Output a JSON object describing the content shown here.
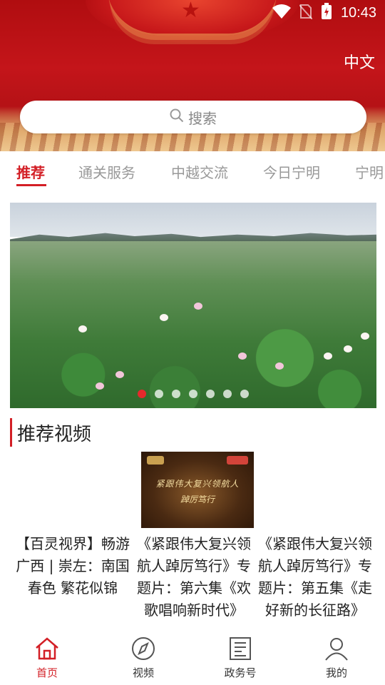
{
  "status": {
    "time": "10:43",
    "icons": [
      "wifi-icon",
      "no-sim-icon",
      "battery-charging-icon"
    ]
  },
  "header": {
    "language": "中文"
  },
  "search": {
    "placeholder": "搜索",
    "icon": "search-icon"
  },
  "tabs": [
    {
      "label": "推荐",
      "active": true
    },
    {
      "label": "通关服务",
      "active": false
    },
    {
      "label": "中越交流",
      "active": false
    },
    {
      "label": "今日宁明",
      "active": false
    },
    {
      "label": "宁明",
      "active": false
    }
  ],
  "banner": {
    "slide_count": 7,
    "active_index": 0
  },
  "section": {
    "title": "推荐视频"
  },
  "video": {
    "thumb_line1": "紧跟伟大复兴领航人",
    "thumb_line2": "踔厉笃行"
  },
  "cards": [
    {
      "title": "【百灵视界】畅游广西 | 崇左：南国春色 繁花似锦",
      "lines": [
        "【百灵视界】畅游",
        "广西 | 崇左：南国",
        "春色 繁花似锦"
      ]
    },
    {
      "title": "《紧跟伟大复兴领航人踔厉笃行》专题片：第六集《欢歌唱响新时代》",
      "lines": [
        "《紧跟伟大复兴领",
        "航人踔厉笃行》专",
        "题片：第六集《欢",
        "歌唱响新时代》"
      ]
    },
    {
      "title": "《紧跟伟大复兴领航人踔厉笃行》专题片：第五集《走好新的长征路》",
      "lines": [
        "《紧跟伟大复兴领",
        "航人踔厉笃行》专",
        "题片：第五集《走",
        "好新的长征路》"
      ]
    }
  ],
  "bottom_nav": [
    {
      "label": "首页",
      "icon": "home-icon",
      "active": true
    },
    {
      "label": "视频",
      "icon": "compass-icon",
      "active": false
    },
    {
      "label": "政务号",
      "icon": "newspaper-icon",
      "active": false
    },
    {
      "label": "我的",
      "icon": "user-icon",
      "active": false
    }
  ],
  "colors": {
    "accent": "#d31f26",
    "header_red": "#c4151a"
  }
}
